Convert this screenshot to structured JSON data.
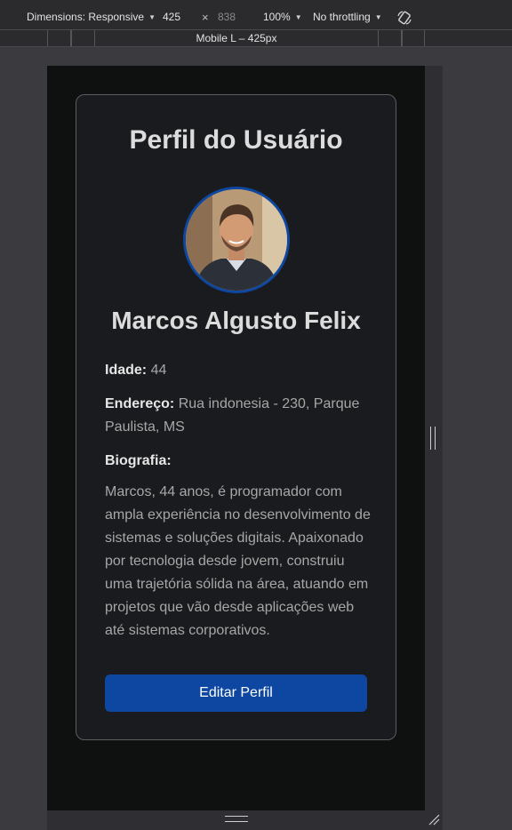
{
  "toolbar": {
    "dimensions_label": "Dimensions: Responsive",
    "width_value": "425",
    "times": "×",
    "height_value": "838",
    "zoom_label": "100%",
    "throttling_label": "No throttling"
  },
  "media_query": {
    "label": "Mobile L – 425px"
  },
  "profile": {
    "title": "Perfil do Usuário",
    "name": "Marcos Algusto Felix",
    "age_label": "Idade:",
    "age_value": "44",
    "address_label": "Endereço:",
    "address_value": "Rua indonesia - 230, Parque Paulista, MS",
    "bio_label": "Biografia:",
    "bio_text": "Marcos, 44 anos, é programador com ampla experiência no desenvolvimento de sistemas e soluções digitais. Apaixonado por tecnologia desde jovem, construiu uma trajetória sólida na área, atuando em projetos que vão desde aplicações web até sistemas corporativos.",
    "edit_button_label": "Editar Perfil"
  },
  "colors": {
    "accent": "#0d47a1",
    "card_background": "#1a1b1e",
    "page_background": "#0f1111"
  }
}
